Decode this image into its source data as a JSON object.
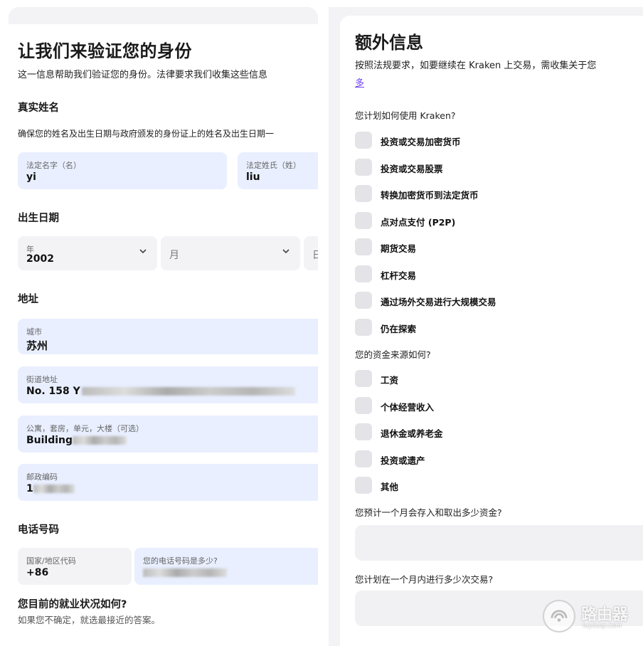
{
  "left": {
    "title": "让我们来验证您的身份",
    "subtitle": "这一信息帮助我们验证您的身份。法律要求我们收集这些信息",
    "legal_name": {
      "heading": "真实姓名",
      "note": "确保您的姓名及出生日期与政府颁发的身份证上的姓名及出生日期一",
      "first_label": "法定名字（名）",
      "first_value": "yi",
      "last_label": "法定姓氏（姓）",
      "last_value": "liu"
    },
    "dob": {
      "heading": "出生日期",
      "year_label": "年",
      "year_value": "2002",
      "month_placeholder": "月",
      "day_placeholder": "日"
    },
    "address": {
      "heading": "地址",
      "city_label": "城市",
      "city_value": "苏州",
      "street_label": "街道地址",
      "street_value": "No. 158 Y",
      "apt_label": "公寓，套房，单元，大楼（可选）",
      "apt_value": "Building",
      "postal_label": "邮政编码",
      "postal_value": "1"
    },
    "phone": {
      "heading": "电话号码",
      "country_label": "国家/地区代码",
      "country_value": "+86",
      "number_label": "您的电话号码是多少?"
    },
    "employment": {
      "heading": "您目前的就业状况如何?",
      "hint": "如果您不确定，就选最接近的答案。"
    }
  },
  "right": {
    "title": "额外信息",
    "intro": "按照法规要求，如要继续在 Kraken 上交易，需收集关于您",
    "intro_link": "多",
    "q1": "您计划如何使用 Kraken?",
    "q1_options": [
      "投资或交易加密货币",
      "投资或交易股票",
      "转换加密货币到法定货币",
      "点对点支付 (P2P)",
      "期货交易",
      "杠杆交易",
      "通过场外交易进行大规模交易",
      "仍在探索"
    ],
    "q2": "您的资金来源如何?",
    "q2_options": [
      "工资",
      "个体经营收入",
      "退休金或养老金",
      "投资或遗产",
      "其他"
    ],
    "q3": "您预计一个月会存入和取出多少资金?",
    "q4": "您计划在一个月内进行多少次交易?"
  },
  "watermark": {
    "name": "路由器",
    "domain": "luyouqi.com"
  },
  "colors": {
    "field_active": "#e9efff",
    "field_idle": "#f3f3f5",
    "checkbox": "#e4e4e8",
    "link": "#6b3ff0"
  }
}
